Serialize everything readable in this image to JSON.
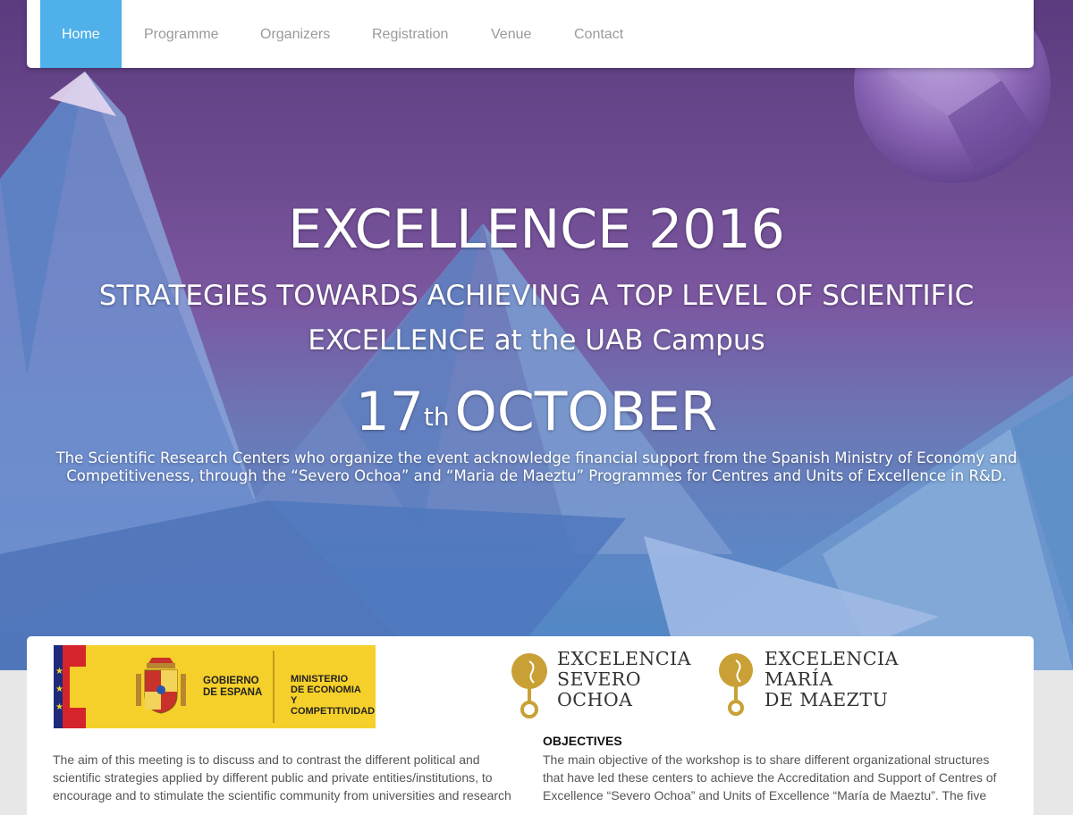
{
  "nav": {
    "items": [
      {
        "label": "Home",
        "active": true
      },
      {
        "label": "Programme",
        "active": false
      },
      {
        "label": "Organizers",
        "active": false
      },
      {
        "label": "Registration",
        "active": false
      },
      {
        "label": "Venue",
        "active": false
      },
      {
        "label": "Contact",
        "active": false
      }
    ]
  },
  "hero": {
    "title": "EXCELLENCE 2016",
    "subtitle": "STRATEGIES TOWARDS ACHIEVING A TOP LEVEL OF SCIENTIFIC EXCELLENCE at the UAB Campus",
    "date_day": "17",
    "date_suffix": "th",
    "date_month": "OCTOBER",
    "acknowledgement": "The Scientific Research Centers who organize the event acknowledge financial support from the Spanish Ministry of Economy and Competitiveness, through the “Severo Ochoa” and “Maria de Maeztu” Programmes for Centres and Units of Excellence in R&D."
  },
  "logos": {
    "gov_line1": "GOBIERNO",
    "gov_line2": "DE ESPANA",
    "ministry_line1": "MINISTERIO",
    "ministry_line2": "DE ECONOMIA",
    "ministry_line3": "Y COMPETITIVIDAD",
    "severo": [
      "EXCELENCIA",
      "SEVERO",
      "OCHOA"
    ],
    "maeztu": [
      "EXCELENCIA",
      "MARÍA",
      "DE MAEZTU"
    ]
  },
  "content": {
    "intro": "The aim of this meeting is to discuss and to contrast the different political and scientific strategies applied by different public and private entities/institutions, to encourage and to stimulate the scientific community from universities and research",
    "objectives_title": "OBJECTIVES",
    "objectives_text": "The main objective of the workshop is to share different organizational structures that have led these centers to achieve the Accreditation and Support of Centres of Excellence “Severo Ochoa” and Units of Excellence “María de Maeztu”. The five"
  },
  "colors": {
    "nav_active": "#4fb0ea",
    "logo_gold": "#c9a035",
    "gov_yellow": "#f6d02a"
  }
}
